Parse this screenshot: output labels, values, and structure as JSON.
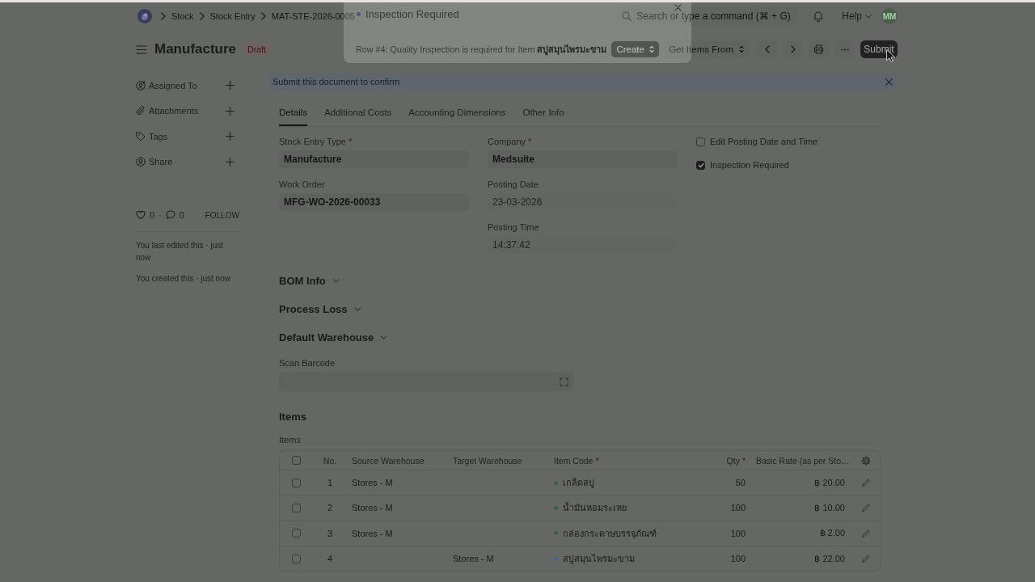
{
  "navbar": {
    "breadcrumbs": [
      {
        "label": "Stock"
      },
      {
        "label": "Stock Entry"
      },
      {
        "label": "MAT-STE-2026-0005"
      }
    ],
    "search": {
      "placeholder": "Search or type a command (⌘ + G)"
    },
    "help": "Help",
    "avatar": "MM"
  },
  "page_head": {
    "title": "Manufacture",
    "status": "Draft",
    "get_items": "Get Items From",
    "submit": "Submit"
  },
  "sidebar": {
    "items": [
      {
        "kind": "assign",
        "label": "Assigned To"
      },
      {
        "kind": "attach",
        "label": "Attachments"
      },
      {
        "kind": "tag",
        "label": "Tags"
      },
      {
        "kind": "share",
        "label": "Share"
      }
    ],
    "likes": "0",
    "separator": "·",
    "comments": "0",
    "follow": "FOLLOW",
    "activity": [
      "You last edited this · just now",
      "You created this · just now"
    ]
  },
  "alert": {
    "text": "Submit this document to confirm"
  },
  "tabs": [
    {
      "label": "Details",
      "selected": true
    },
    {
      "label": "Additional Costs",
      "selected": false
    },
    {
      "label": "Accounting Dimensions",
      "selected": false
    },
    {
      "label": "Other Info",
      "selected": false
    }
  ],
  "form": {
    "columns": [
      {
        "fields": [
          {
            "kind": "input",
            "label": "Stock Entry Type",
            "required_mark": "*",
            "value": "Manufacture",
            "disabled": false
          },
          {
            "kind": "input",
            "label": "Work Order",
            "value": "MFG-WO-2026-00033",
            "disabled": false
          }
        ]
      },
      {
        "fields": [
          {
            "kind": "input",
            "label": "Company",
            "required_mark": "*",
            "value": "Medsuite",
            "disabled": false
          },
          {
            "kind": "input",
            "label": "Posting Date",
            "value": "23-03-2026",
            "disabled": true
          },
          {
            "kind": "input",
            "label": "Posting Time",
            "value": "14:37:42",
            "disabled": true
          }
        ]
      },
      {
        "fields": [
          {
            "kind": "checkbox",
            "label": "Edit Posting Date and Time",
            "checked": false
          },
          {
            "kind": "checkbox",
            "label": "Inspection Required",
            "checked": true
          }
        ]
      }
    ]
  },
  "sections": [
    {
      "title": "BOM Info",
      "expanded": false
    },
    {
      "title": "Process Loss",
      "expanded": false
    },
    {
      "title": "Default Warehouse",
      "expanded": false
    }
  ],
  "scan_barcode": {
    "label": "Scan Barcode"
  },
  "items": {
    "heading": "Items",
    "label": "Items",
    "all_checked": false,
    "columns": [
      {
        "label": "No."
      },
      {
        "label": "Source Warehouse"
      },
      {
        "label": "Target Warehouse"
      },
      {
        "label": "Item Code",
        "required_mark": "*"
      },
      {
        "label": "Qty",
        "required_mark": "*"
      },
      {
        "label": "Basic Rate (as per Sto…"
      }
    ],
    "rows": [
      {
        "checked": false,
        "no": "1",
        "source_warehouse": "Stores - M",
        "item_code": "เกล็ดสบู่",
        "color": "#3f5f49",
        "qty": "50",
        "rate": "฿ 20.00"
      },
      {
        "checked": false,
        "no": "2",
        "source_warehouse": "Stores - M",
        "item_code": "น้ำมันหอมระเหย",
        "color": "#3f5f49",
        "qty": "100",
        "rate": "฿ 10.00"
      },
      {
        "checked": false,
        "no": "3",
        "source_warehouse": "Stores - M",
        "item_code": "กล่องกระดาษบรรจุภัณฑ์",
        "color": "#3f5f49",
        "qty": "100",
        "rate": "฿ 2.00"
      },
      {
        "checked": false,
        "no": "4",
        "target_warehouse": "Stores - M",
        "item_code": "สบู่สมุนไพรมะขาม",
        "color": "#4f5e93",
        "qty": "100",
        "rate": "฿ 22.00"
      }
    ]
  },
  "dialog": {
    "title": "Inspection Required",
    "message": "Row #4: Quality Inspection is required for Item **สบู่สมุนไพรมะขาม**",
    "button": "Create"
  }
}
